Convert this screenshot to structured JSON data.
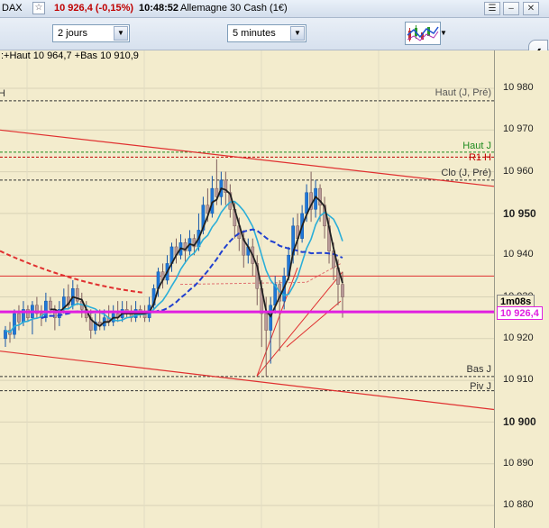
{
  "titlebar": {
    "symbol": "DAX",
    "price_change": "10 926,4 (-0,15%)",
    "time": "10:48:52",
    "instrument": "Allemagne 30 Cash (1€)",
    "star_icon": "☆"
  },
  "toolbar": {
    "period": "2 jours",
    "interval": "5 minutes"
  },
  "legend": ":+Haut 10 964,7 +Bas 10 910,9",
  "chart_data": {
    "type": "line",
    "y_ticks": [
      "10 980",
      "10 970",
      "10 960",
      "10 950",
      "10 940",
      "10 930",
      "10 920",
      "10 910",
      "10 900",
      "10 890",
      "10 880"
    ],
    "y_tick_values": [
      10980,
      10970,
      10960,
      10950,
      10940,
      10930,
      10920,
      10910,
      10900,
      10890,
      10880
    ],
    "bold_ticks": [
      10950,
      10900
    ],
    "ylim": [
      10876,
      10985
    ],
    "levels": [
      {
        "label": "H",
        "value": 10977,
        "color": "#333333",
        "side": "left"
      },
      {
        "label": "Haut (J, Pré)",
        "value": 10977,
        "color": "#555555",
        "side": "right"
      },
      {
        "label": "Haut J",
        "value": 10964.7,
        "color": "#1e8a1e",
        "side": "right"
      },
      {
        "label": "R1 H",
        "value": 10963.5,
        "color": "#c00000",
        "side": "right"
      },
      {
        "label": "Clo (J, Pré)",
        "value": 10958,
        "color": "#333333",
        "side": "right"
      },
      {
        "label": "Bas J",
        "value": 10910.9,
        "color": "#333333",
        "side": "right"
      },
      {
        "label": "Piv J",
        "value": 10907.5,
        "color": "#333333",
        "side": "right"
      }
    ],
    "current_price_label": "10 926,4",
    "current_price": 10926.4,
    "countdown_label": "1m08s",
    "candles": [
      [
        10920,
        10922,
        10918,
        10923
      ],
      [
        10922,
        10921,
        10919,
        10924
      ],
      [
        10921,
        10926,
        10920,
        10927
      ],
      [
        10926,
        10924,
        10922,
        10928
      ],
      [
        10924,
        10927,
        10923,
        10929
      ],
      [
        10927,
        10925,
        10924,
        10928
      ],
      [
        10925,
        10928,
        10921,
        10929
      ],
      [
        10928,
        10926,
        10925,
        10930
      ],
      [
        10926,
        10925,
        10923,
        10928
      ],
      [
        10925,
        10929,
        10924,
        10931
      ],
      [
        10929,
        10927,
        10926,
        10930
      ],
      [
        10927,
        10925,
        10922,
        10928
      ],
      [
        10925,
        10927,
        10923,
        10929
      ],
      [
        10927,
        10930,
        10926,
        10932
      ],
      [
        10930,
        10928,
        10927,
        10933
      ],
      [
        10928,
        10932,
        10927,
        10934
      ],
      [
        10932,
        10929,
        10928,
        10933
      ],
      [
        10929,
        10927,
        10925,
        10931
      ],
      [
        10927,
        10925,
        10924,
        10929
      ],
      [
        10925,
        10922,
        10920,
        10927
      ],
      [
        10922,
        10924,
        10921,
        10926
      ],
      [
        10924,
        10923,
        10922,
        10927
      ],
      [
        10923,
        10925,
        10922,
        10927
      ],
      [
        10925,
        10924,
        10923,
        10928
      ],
      [
        10924,
        10926,
        10923,
        10928
      ],
      [
        10926,
        10925,
        10924,
        10929
      ],
      [
        10925,
        10927,
        10924,
        10929
      ],
      [
        10927,
        10926,
        10925,
        10929
      ],
      [
        10926,
        10925,
        10924,
        10928
      ],
      [
        10925,
        10927,
        10924,
        10929
      ],
      [
        10927,
        10926,
        10925,
        10928
      ],
      [
        10926,
        10925,
        10924,
        10928
      ],
      [
        10925,
        10928,
        10924,
        10930
      ],
      [
        10928,
        10932,
        10927,
        10933
      ],
      [
        10932,
        10936,
        10930,
        10937
      ],
      [
        10936,
        10934,
        10932,
        10938
      ],
      [
        10934,
        10938,
        10933,
        10940
      ],
      [
        10938,
        10942,
        10936,
        10943
      ],
      [
        10942,
        10940,
        10938,
        10944
      ],
      [
        10940,
        10943,
        10939,
        10945
      ],
      [
        10943,
        10941,
        10938,
        10944
      ],
      [
        10941,
        10944,
        10940,
        10946
      ],
      [
        10944,
        10942,
        10940,
        10945
      ],
      [
        10942,
        10946,
        10941,
        10950
      ],
      [
        10946,
        10952,
        10945,
        10954
      ],
      [
        10952,
        10950,
        10948,
        10956
      ],
      [
        10950,
        10956,
        10949,
        10959
      ],
      [
        10956,
        10954,
        10952,
        10963
      ],
      [
        10954,
        10958,
        10952,
        10960
      ],
      [
        10958,
        10955,
        10952,
        10960
      ],
      [
        10955,
        10951,
        10949,
        10957
      ],
      [
        10951,
        10947,
        10944,
        10953
      ],
      [
        10947,
        10944,
        10941,
        10949
      ],
      [
        10944,
        10940,
        10937,
        10946
      ],
      [
        10940,
        10942,
        10938,
        10944
      ],
      [
        10942,
        10938,
        10935,
        10944
      ],
      [
        10938,
        10932,
        10928,
        10940
      ],
      [
        10932,
        10926,
        10918,
        10934
      ],
      [
        10926,
        10922,
        10911,
        10930
      ],
      [
        10922,
        10928,
        10914,
        10930
      ],
      [
        10928,
        10933,
        10926,
        10935
      ],
      [
        10933,
        10929,
        10917,
        10934
      ],
      [
        10929,
        10935,
        10927,
        10937
      ],
      [
        10935,
        10940,
        10934,
        10942
      ],
      [
        10940,
        10947,
        10938,
        10949
      ],
      [
        10947,
        10944,
        10940,
        10950
      ],
      [
        10944,
        10950,
        10943,
        10952
      ],
      [
        10950,
        10955,
        10948,
        10957
      ],
      [
        10955,
        10951,
        10948,
        10960
      ],
      [
        10951,
        10956,
        10949,
        10958
      ],
      [
        10956,
        10952,
        10948,
        10957
      ],
      [
        10952,
        10947,
        10944,
        10954
      ],
      [
        10947,
        10941,
        10938,
        10949
      ],
      [
        10941,
        10937,
        10934,
        10943
      ],
      [
        10937,
        10933,
        10928,
        10939
      ],
      [
        10933,
        10930,
        10925,
        10936
      ]
    ]
  }
}
